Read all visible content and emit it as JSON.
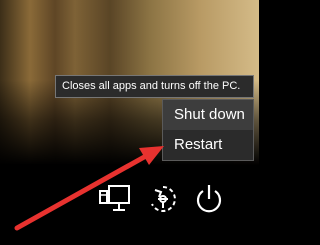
{
  "tooltip": {
    "text": "Closes all apps and turns off the PC."
  },
  "power_menu": {
    "items": [
      {
        "label": "Shut down",
        "highlighted": true
      },
      {
        "label": "Restart",
        "highlighted": false
      }
    ]
  },
  "bottom_bar": {
    "icons": [
      "network-icon",
      "accessibility-icon",
      "power-icon"
    ]
  },
  "annotation": {
    "arrow_color": "#e8322f"
  },
  "colors": {
    "menu_bg": "#2b2b2b",
    "menu_hover": "#3d3d3d",
    "text": "#ffffff"
  }
}
